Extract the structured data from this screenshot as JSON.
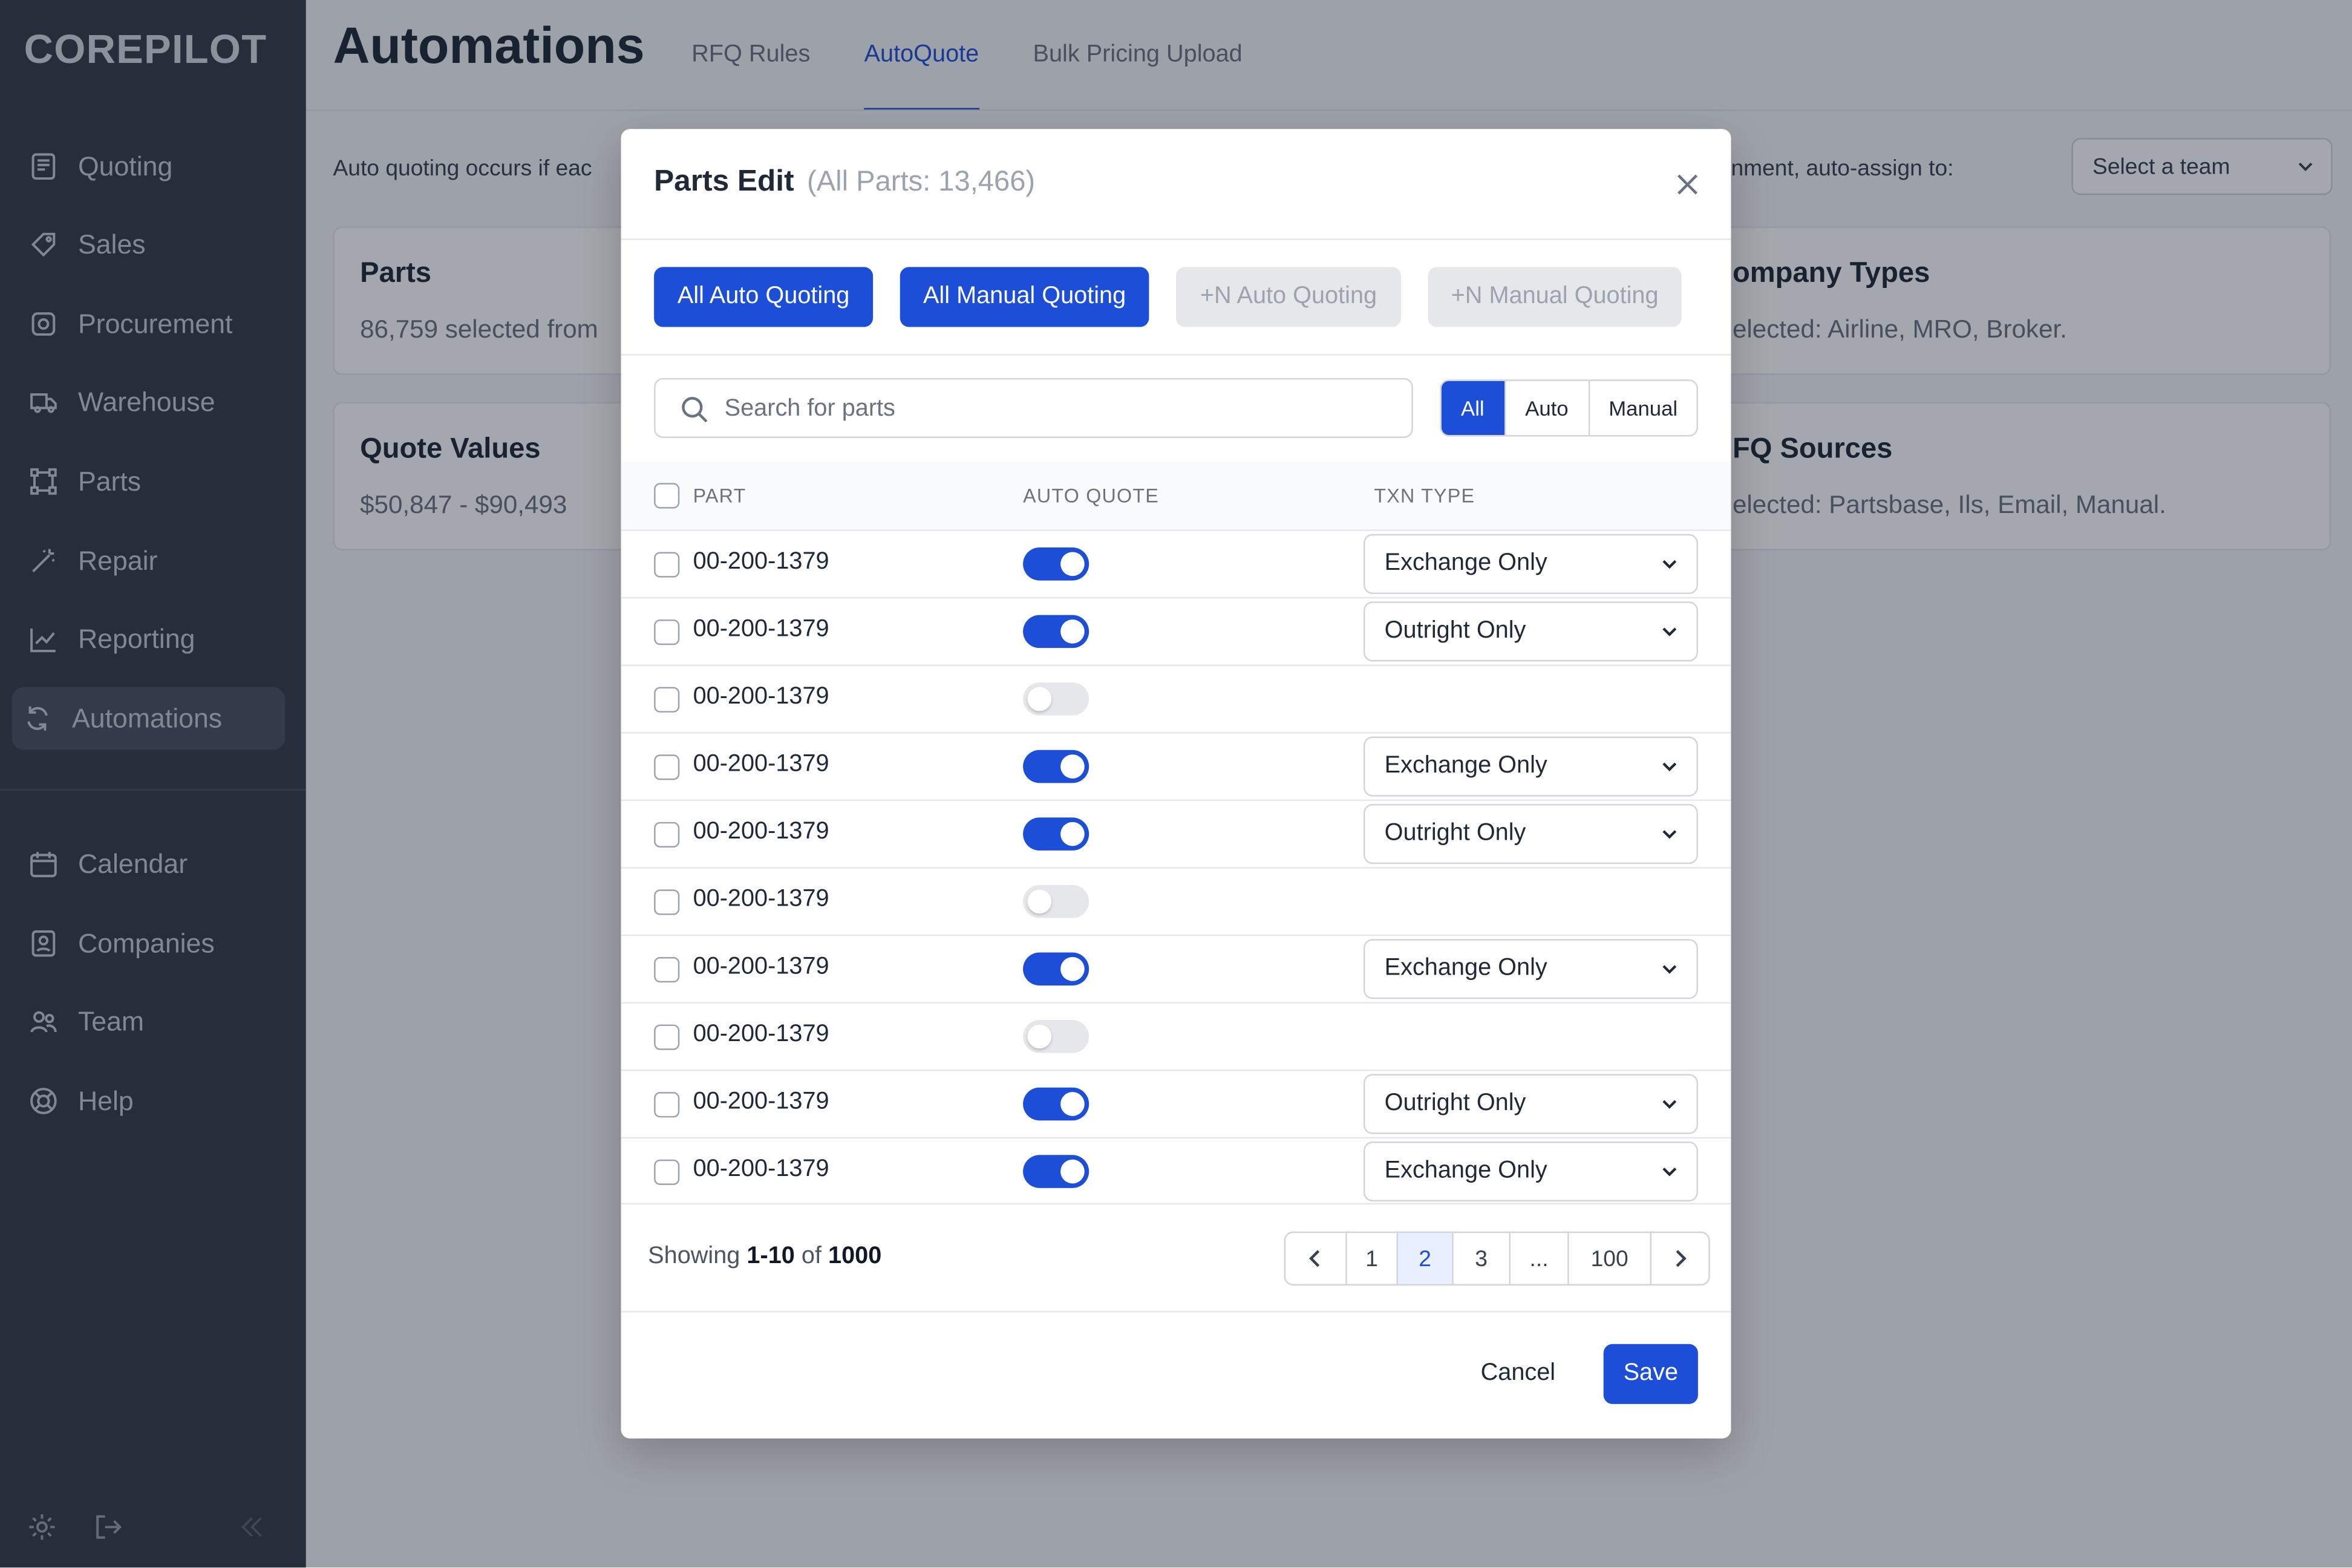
{
  "brand": "COREPILOT",
  "sidebar": {
    "items": [
      {
        "label": "Quoting",
        "icon": "quote-sheet-icon"
      },
      {
        "label": "Sales",
        "icon": "tag-icon"
      },
      {
        "label": "Procurement",
        "icon": "box-icon"
      },
      {
        "label": "Warehouse",
        "icon": "truck-icon"
      },
      {
        "label": "Parts",
        "icon": "parts-icon"
      },
      {
        "label": "Repair",
        "icon": "wand-icon"
      },
      {
        "label": "Reporting",
        "icon": "chart-line-icon"
      },
      {
        "label": "Automations",
        "icon": "refresh-icon",
        "active": true
      }
    ],
    "secondary": [
      {
        "label": "Calendar",
        "icon": "calendar-icon"
      },
      {
        "label": "Companies",
        "icon": "contacts-icon"
      },
      {
        "label": "Team",
        "icon": "team-icon"
      },
      {
        "label": "Help",
        "icon": "lifebuoy-icon"
      }
    ]
  },
  "header": {
    "title": "Automations",
    "tabs": [
      "RFQ Rules",
      "AutoQuote",
      "Bulk Pricing Upload"
    ],
    "active_tab": "AutoQuote"
  },
  "background": {
    "description_left": "Auto quoting occurs if eac",
    "description_right": "nment, auto-assign to:",
    "team_select": "Select a team",
    "cards": {
      "parts": {
        "title": "Parts",
        "sub": "86,759 selected from"
      },
      "quote_values": {
        "title": "Quote Values",
        "sub": "$50,847 - $90,493"
      },
      "company_types": {
        "title": "ompany Types",
        "sub": "elected: Airline, MRO, Broker."
      },
      "rfq_sources": {
        "title": "FQ Sources",
        "sub": "elected: Partsbase, Ils, Email, Manual."
      }
    }
  },
  "modal": {
    "title": "Parts Edit",
    "count": "(All Parts: 13,466)",
    "quick_buttons": [
      "All Auto Quoting",
      "All Manual Quoting",
      "+N Auto Quoting",
      "+N Manual Quoting"
    ],
    "search_placeholder": "Search for parts",
    "filter": [
      "All",
      "Auto",
      "Manual"
    ],
    "filter_active": "All",
    "columns": [
      "PART",
      "AUTO QUOTE",
      "TXN TYPE"
    ],
    "rows": [
      {
        "part": "00-200-1379",
        "auto": true,
        "txn": "Exchange Only"
      },
      {
        "part": "00-200-1379",
        "auto": true,
        "txn": "Outright Only"
      },
      {
        "part": "00-200-1379",
        "auto": false,
        "txn": ""
      },
      {
        "part": "00-200-1379",
        "auto": true,
        "txn": "Exchange Only"
      },
      {
        "part": "00-200-1379",
        "auto": true,
        "txn": "Outright Only"
      },
      {
        "part": "00-200-1379",
        "auto": false,
        "txn": ""
      },
      {
        "part": "00-200-1379",
        "auto": true,
        "txn": "Exchange Only"
      },
      {
        "part": "00-200-1379",
        "auto": false,
        "txn": ""
      },
      {
        "part": "00-200-1379",
        "auto": true,
        "txn": "Outright Only"
      },
      {
        "part": "00-200-1379",
        "auto": true,
        "txn": "Exchange Only"
      }
    ],
    "footer": {
      "showing_prefix": "Showing",
      "showing_range": "1-10",
      "showing_of": "of",
      "showing_total": "1000",
      "pages": [
        "1",
        "2",
        "3",
        "...",
        "100"
      ],
      "current_page": "2"
    },
    "cancel": "Cancel",
    "save": "Save"
  },
  "colors": {
    "accent": "#1d4ed8",
    "sidebar": "#343c49",
    "overlay": "rgba(17,24,39,0.38)"
  }
}
